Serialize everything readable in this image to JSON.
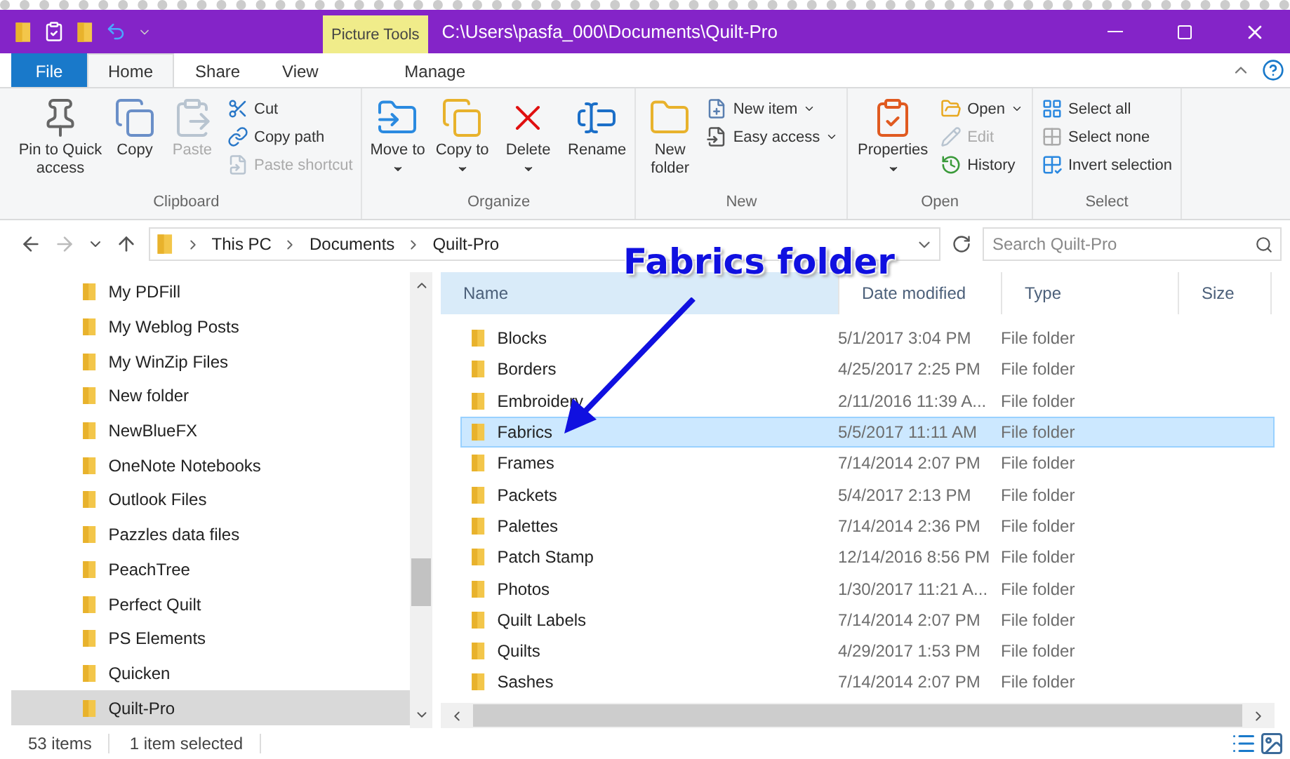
{
  "title_bar": {
    "context_tab": "Picture Tools",
    "path": "C:\\Users\\pasfa_000\\Documents\\Quilt-Pro"
  },
  "ribbon_tabs": [
    {
      "label": "File",
      "kind": "file",
      "selected": false
    },
    {
      "label": "Home",
      "kind": "tab",
      "selected": true
    },
    {
      "label": "Share",
      "kind": "tab",
      "selected": false
    },
    {
      "label": "View",
      "kind": "tab",
      "selected": false
    },
    {
      "label": "Manage",
      "kind": "context",
      "selected": false
    }
  ],
  "ribbon_groups": [
    {
      "label": "Clipboard",
      "items": [
        {
          "label": "Pin to Quick access",
          "kind": "large",
          "disabled": false,
          "dropdown": false
        },
        {
          "label": "Copy",
          "kind": "large",
          "disabled": false,
          "dropdown": false
        },
        {
          "label": "Paste",
          "kind": "large",
          "disabled": true,
          "dropdown": false
        },
        {
          "label": "Cut",
          "kind": "small",
          "disabled": false,
          "dropdown": false
        },
        {
          "label": "Copy path",
          "kind": "small",
          "disabled": false,
          "dropdown": false
        },
        {
          "label": "Paste shortcut",
          "kind": "small",
          "disabled": true,
          "dropdown": false
        }
      ]
    },
    {
      "label": "Organize",
      "items": [
        {
          "label": "Move to",
          "kind": "large",
          "disabled": false,
          "dropdown": true
        },
        {
          "label": "Copy to",
          "kind": "large",
          "disabled": false,
          "dropdown": true
        },
        {
          "label": "Delete",
          "kind": "large",
          "disabled": false,
          "dropdown": true
        },
        {
          "label": "Rename",
          "kind": "large",
          "disabled": false,
          "dropdown": false
        }
      ]
    },
    {
      "label": "New",
      "items": [
        {
          "label": "New folder",
          "kind": "large",
          "disabled": false,
          "dropdown": false
        },
        {
          "label": "New item",
          "kind": "small",
          "disabled": false,
          "dropdown": true
        },
        {
          "label": "Easy access",
          "kind": "small",
          "disabled": false,
          "dropdown": true
        }
      ]
    },
    {
      "label": "Open",
      "items": [
        {
          "label": "Properties",
          "kind": "large",
          "disabled": false,
          "dropdown": true
        },
        {
          "label": "Open",
          "kind": "small",
          "disabled": false,
          "dropdown": true
        },
        {
          "label": "Edit",
          "kind": "small",
          "disabled": true,
          "dropdown": false
        },
        {
          "label": "History",
          "kind": "small",
          "disabled": false,
          "dropdown": false
        }
      ]
    },
    {
      "label": "Select",
      "items": [
        {
          "label": "Select all",
          "kind": "small",
          "disabled": false,
          "dropdown": false
        },
        {
          "label": "Select none",
          "kind": "small",
          "disabled": false,
          "dropdown": false
        },
        {
          "label": "Invert selection",
          "kind": "small",
          "disabled": false,
          "dropdown": false
        }
      ]
    }
  ],
  "address": {
    "crumbs": [
      "This PC",
      "Documents",
      "Quilt-Pro"
    ]
  },
  "search": {
    "placeholder": "Search Quilt-Pro"
  },
  "nav_pane": [
    {
      "label": "My PDFill",
      "selected": false
    },
    {
      "label": "My Weblog Posts",
      "selected": false
    },
    {
      "label": "My WinZip Files",
      "selected": false
    },
    {
      "label": "New folder",
      "selected": false
    },
    {
      "label": "NewBlueFX",
      "selected": false
    },
    {
      "label": "OneNote Notebooks",
      "selected": false
    },
    {
      "label": "Outlook Files",
      "selected": false
    },
    {
      "label": "Pazzles data files",
      "selected": false
    },
    {
      "label": "PeachTree",
      "selected": false
    },
    {
      "label": "Perfect Quilt",
      "selected": false
    },
    {
      "label": "PS Elements",
      "selected": false
    },
    {
      "label": "Quicken",
      "selected": false
    },
    {
      "label": "Quilt-Pro",
      "selected": true
    }
  ],
  "table": {
    "columns": [
      "Name",
      "Date modified",
      "Type",
      "Size"
    ],
    "rows": [
      {
        "name": "Blocks",
        "date": "5/1/2017 3:04 PM",
        "type": "File folder",
        "selected": false
      },
      {
        "name": "Borders",
        "date": "4/25/2017 2:25 PM",
        "type": "File folder",
        "selected": false
      },
      {
        "name": "Embroidery",
        "date": "2/11/2016 11:39 A...",
        "type": "File folder",
        "selected": false
      },
      {
        "name": "Fabrics",
        "date": "5/5/2017 11:11 AM",
        "type": "File folder",
        "selected": true
      },
      {
        "name": "Frames",
        "date": "7/14/2014 2:07 PM",
        "type": "File folder",
        "selected": false
      },
      {
        "name": "Packets",
        "date": "5/4/2017 2:13 PM",
        "type": "File folder",
        "selected": false
      },
      {
        "name": "Palettes",
        "date": "7/14/2014 2:36 PM",
        "type": "File folder",
        "selected": false
      },
      {
        "name": "Patch Stamp",
        "date": "12/14/2016 8:56 PM",
        "type": "File folder",
        "selected": false
      },
      {
        "name": "Photos",
        "date": "1/30/2017 11:21 A...",
        "type": "File folder",
        "selected": false
      },
      {
        "name": "Quilt Labels",
        "date": "7/14/2014 2:07 PM",
        "type": "File folder",
        "selected": false
      },
      {
        "name": "Quilts",
        "date": "4/29/2017 1:53 PM",
        "type": "File folder",
        "selected": false
      },
      {
        "name": "Sashes",
        "date": "7/14/2014 2:07 PM",
        "type": "File folder",
        "selected": false
      }
    ]
  },
  "annotation": {
    "label": "Fabrics folder"
  },
  "status_bar": [
    "53 items",
    "1 item selected"
  ]
}
